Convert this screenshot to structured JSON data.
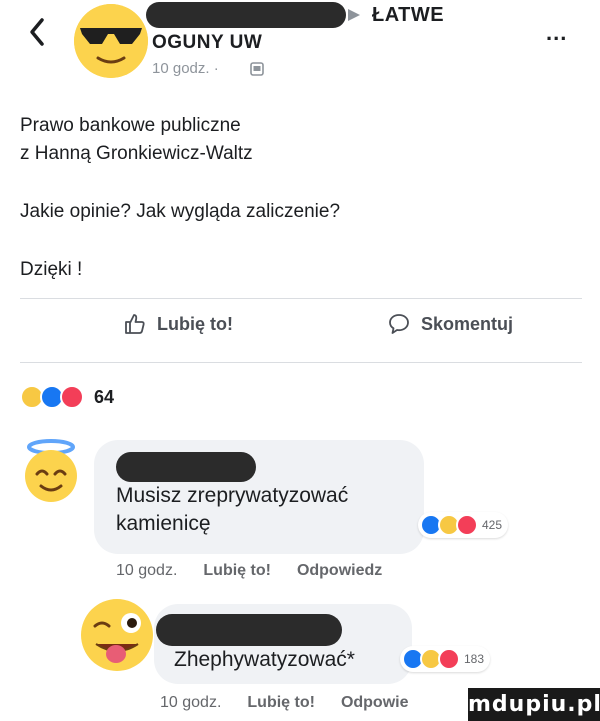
{
  "header": {
    "group_name": "ŁATWE",
    "page_name": "OGUNY UW",
    "time": "10 godz. ·",
    "back_icon": "chevron-left-icon",
    "more_icon": "more-horizontal-icon",
    "more_label": "..."
  },
  "post": {
    "line1": "Prawo bankowe publiczne",
    "line2": "z Hanną Gronkiewicz-Waltz",
    "line3": "Jakie opinie? Jak wygląda zaliczenie?",
    "line4": "Dzięki !"
  },
  "actions": {
    "like_label": "Lubię to!",
    "comment_label": "Skomentuj"
  },
  "reactions": {
    "count": "64",
    "colors": {
      "haha": "#f7c843",
      "like": "#1877f2",
      "love": "#f33e58"
    }
  },
  "comments": [
    {
      "text_line1": "Musisz zreprywatyzować",
      "text_line2": "kamienicę",
      "reaction_count": "425",
      "time": "10 godz.",
      "like": "Lubię to!",
      "reply": "Odpowiedz"
    },
    {
      "text_line1": "Zhephywatyzować*",
      "reaction_count": "183",
      "time": "10 godz.",
      "like": "Lubię to!",
      "reply": "Odpowie"
    }
  ],
  "watermark": "mdupiu.pl"
}
